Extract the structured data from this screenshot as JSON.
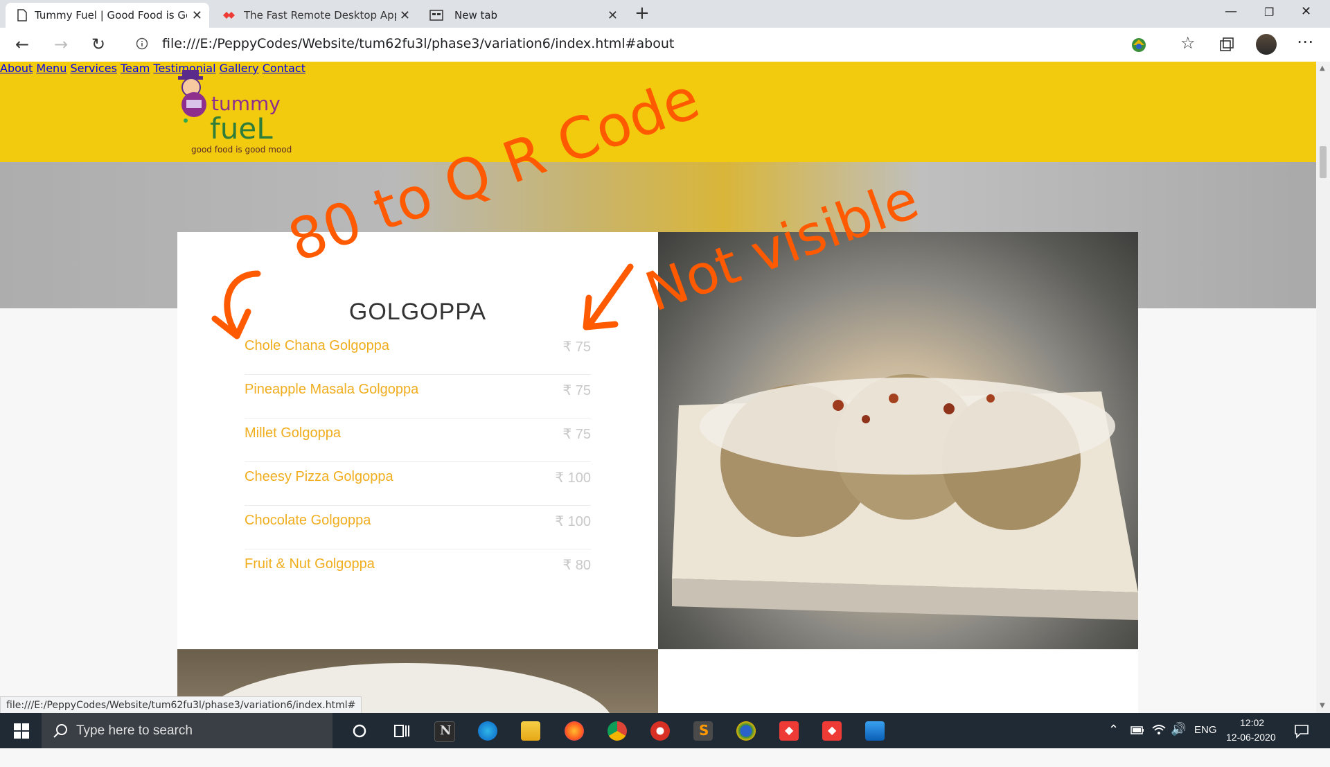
{
  "browser": {
    "tabs": [
      {
        "title": "Tummy Fuel | Good Food is Goo",
        "active": true
      },
      {
        "title": "The Fast Remote Desktop Applic",
        "active": false
      },
      {
        "title": "New tab",
        "active": false
      }
    ],
    "address": "file:///E:/PeppyCodes/Website/tum62fu3l/phase3/variation6/index.html#about",
    "status_url": "file:///E:/PeppyCodes/Website/tum62fu3l/phase3/variation6/index.html#"
  },
  "site": {
    "logo": {
      "line1": "tummy",
      "line2": "fueL",
      "tagline": "good food is good mood"
    },
    "nav": [
      "About",
      "Menu",
      "Services",
      "Team",
      "Testimonial",
      "Gallery",
      "Contact"
    ],
    "menu_card": {
      "title": "GOLGOPPA",
      "items": [
        {
          "name": "Chole Chana Golgoppa",
          "price": "₹ 75"
        },
        {
          "name": "Pineapple Masala Golgoppa",
          "price": "₹ 75"
        },
        {
          "name": "Millet Golgoppa",
          "price": "₹ 75"
        },
        {
          "name": "Cheesy Pizza Golgoppa",
          "price": "₹ 100"
        },
        {
          "name": "Chocolate Golgoppa",
          "price": "₹ 100"
        },
        {
          "name": "Fruit & Nut Golgoppa",
          "price": "₹ 80"
        }
      ]
    }
  },
  "annotations": {
    "note1": "80 to Q R Code",
    "note2": "Not visible"
  },
  "taskbar": {
    "search_placeholder": "Type here to search",
    "language": "ENG",
    "time": "12:02",
    "date": "12-06-2020"
  },
  "colors": {
    "header_bg": "#f2ca0e",
    "menu_item_text": "#f0ad1e",
    "annotation": "#ff5a00"
  }
}
